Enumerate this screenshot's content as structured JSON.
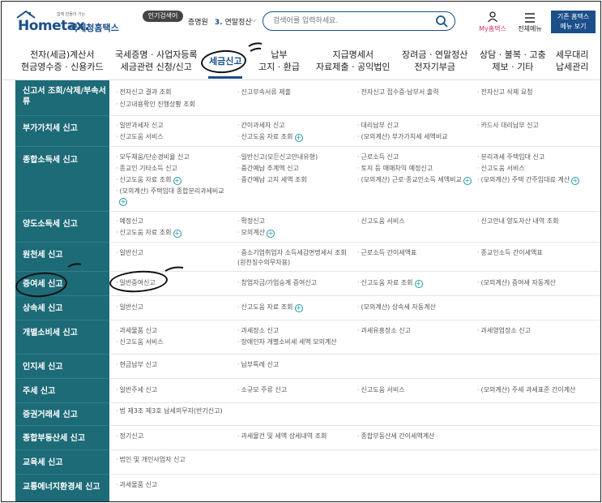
{
  "header": {
    "logo_brand": "Hometax.",
    "logo_kr": "국세청홈택스",
    "logo_tagline": "함께 만들어 가는",
    "popular_badge": "인기검색어",
    "popular_prefix": "증명원",
    "popular_rank": "3.",
    "popular_term": "연말정산",
    "search_placeholder": "검색어를 입력하세요.",
    "my_label": "My홈택스",
    "menu_label": "전체메뉴",
    "legacy_line1": "기존 홈택스",
    "legacy_line2": "메뉴 보기"
  },
  "nav": [
    {
      "l1": "전자(세금)계산서",
      "l2": "현금영수증 · 신용카드"
    },
    {
      "l1": "국세증명 · 사업자등록",
      "l2": "세금관련 신청/신고"
    },
    {
      "l1": "세금신고",
      "l2": ""
    },
    {
      "l1": "납부",
      "l2": "고지 · 환급"
    },
    {
      "l1": "지급명세서",
      "l2": "자료제출 · 공익법인"
    },
    {
      "l1": "장려금 · 연말정산",
      "l2": "전자기부금"
    },
    {
      "l1": "상담 · 불복 · 고충",
      "l2": "제보 · 기타"
    },
    {
      "l1": "세무대리",
      "l2": "납세관리"
    }
  ],
  "rows": [
    {
      "label": "신고서 조회/삭제/부속서류",
      "items": [
        "전자신고 결과 조회",
        "신고부속서류 제출",
        "전자신고 접수증·납부서 출력",
        "전자신고 삭제 요청",
        "신고내용확인 진행상황 조회"
      ]
    },
    {
      "label": "부가가치세 신고",
      "items": [
        "일반과세자 신고",
        "간이과세자 신고",
        "대리납부 신고",
        "카드사 대리납부 신고",
        "신고도움 서비스",
        "신고도움 자료 조회",
        "(모의계산) 부가가치세 세액비교"
      ]
    },
    {
      "label": "종합소득세 신고",
      "items": [
        "모두채움/단순경비율 신고",
        "일반신고(모든신고안내유형)",
        "근로소득 신고",
        "분리과세 주택임대 신고",
        "종교인 기타소득 신고",
        "중간예납 추계액 신고",
        "토지 등 매매차익 예정신고",
        "신고도움 서비스",
        "신고도움 자료 조회",
        "중간예납 고지 세액 조회",
        "(모의계산) 근로·종교인소득 세액비교",
        "(모의계산) 주택 간주임대료 계산",
        "(모의계산) 주택임대 종합분리과세비교"
      ]
    },
    {
      "label": "양도소득세 신고",
      "items": [
        "예정신고",
        "확정신고",
        "신고도움 서비스",
        "신고안내 양도자산 내역 조회",
        "신고도움 자료 조회",
        "모의계산"
      ]
    },
    {
      "label": "원천세 신고",
      "items": [
        "일반신고",
        "중소기업취업자 소득세감면명세서 조회 (원천징수의무자용)",
        "근로소득 간이세액표",
        "종교인소득 간이세액표"
      ]
    },
    {
      "label": "증여세 신고",
      "items": [
        "일반증여신고",
        "창업자금/가업승계 증여신고",
        "신고도움 자료 조회",
        "(모의계산) 증여세 자동계산"
      ]
    },
    {
      "label": "상속세 신고",
      "items": [
        "일반신고",
        "신고도움 자료 조회",
        "(모의계산) 상속세 자동계산"
      ]
    },
    {
      "label": "개별소비세 신고",
      "items": [
        "과세물품 신고",
        "과세장소 신고",
        "과세유흥장소 신고",
        "과세영업장소 신고",
        "신고도움 서비스",
        "장애인차 개별소비세 세액 모의계산"
      ]
    },
    {
      "label": "인지세 신고",
      "items": [
        "현금납부 신고",
        "납부특례 신고"
      ]
    },
    {
      "label": "주세 신고",
      "items": [
        "일반주세 신고",
        "소규모 주류 신고",
        "신고도움 서비스",
        "(모의계산) 주세 과세표준 간이계산"
      ]
    },
    {
      "label": "증권거래세 신고",
      "items": [
        "법 제3조 제3호 납세의무자(반기신고)"
      ]
    },
    {
      "label": "종합부동산세 신고",
      "items": [
        "정기신고",
        "과세물건 및 세액 상세내역 조회",
        "종합부동산세 간이세액계산"
      ]
    },
    {
      "label": "교육세 신고",
      "items": [
        "법인 및 개인사업자 신고"
      ]
    },
    {
      "label": "교통에너지환경세 신고",
      "items": [
        "과세물품 신고"
      ]
    }
  ],
  "colors": {
    "brand": "#1b4f8a",
    "sidebar": "#1e6b78",
    "accent_pink": "#d6336c",
    "plus": "#1e9aa8"
  }
}
